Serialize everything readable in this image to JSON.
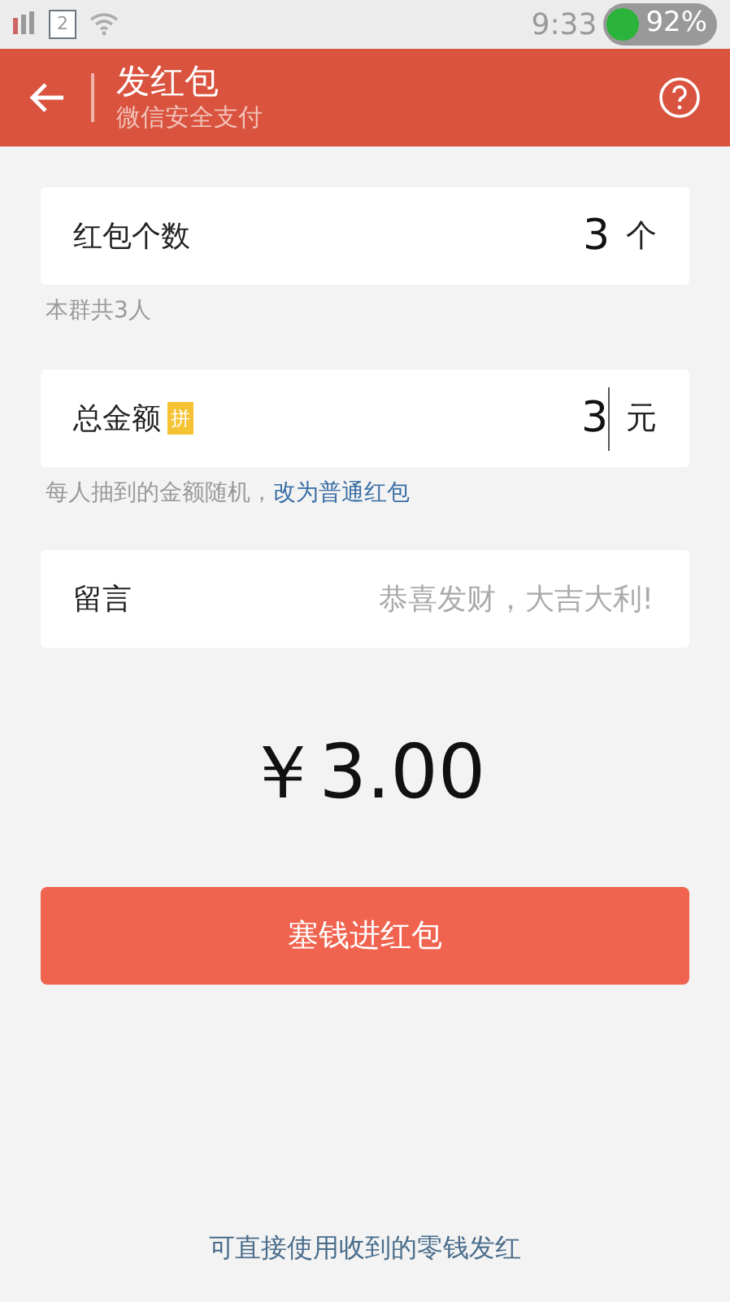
{
  "status_bar": {
    "sim": "2",
    "time": "9:33",
    "battery": "92%"
  },
  "header": {
    "title": "发红包",
    "subtitle": "微信安全支付"
  },
  "fields": [
    {
      "kind": "number",
      "label": "红包个数",
      "value": "3",
      "unit": "个",
      "hint": "本群共3人"
    },
    {
      "kind": "amount",
      "label": "总金额",
      "tag": "拼",
      "value": "3",
      "unit": "元",
      "hint": "每人抽到的金额随机，",
      "hint_link": "改为普通红包"
    },
    {
      "kind": "message",
      "label": "留言",
      "placeholder": "恭喜发财，大吉大利!"
    }
  ],
  "total": "￥3.00",
  "submit_button": "塞钱进红包",
  "footer": "可直接使用收到的零钱发红"
}
